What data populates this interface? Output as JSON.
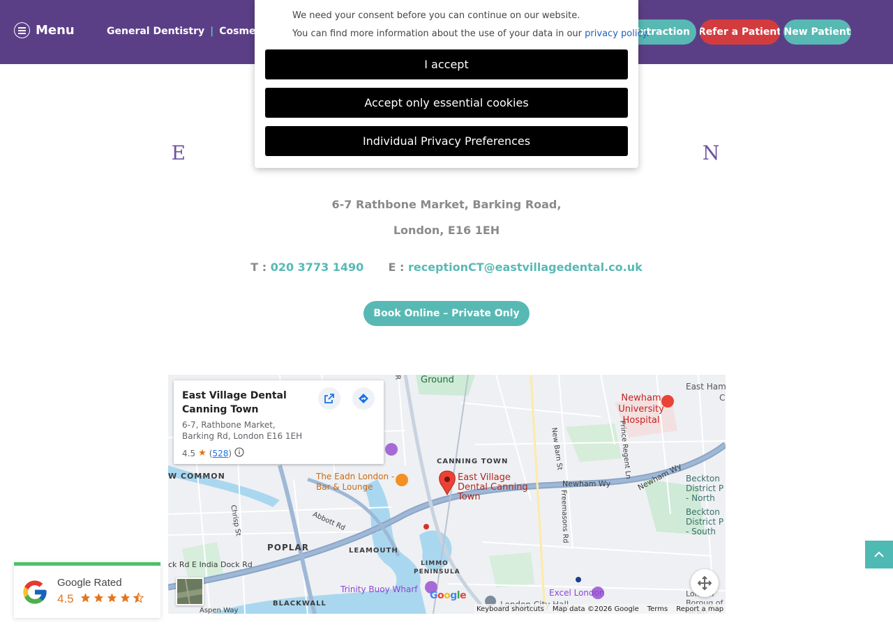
{
  "header": {
    "menu_label": "Menu",
    "nav": [
      "General Dentistry",
      "Cosmetic De"
    ],
    "buttons": {
      "extraction": "n Extraction",
      "refer": "Refer a Patient",
      "new_patient": "New Patient"
    }
  },
  "main": {
    "title": "E                                                              N",
    "address_line1": "6-7 Rathbone Market, Barking Road,",
    "address_line2": "London, E16 1EH",
    "phone_prefix": "T :",
    "phone": "020 3773 1490",
    "email_prefix": "E :",
    "email": "receptionCT@eastvillagedental.co.uk",
    "book_button": "Book Online – Private Only"
  },
  "map": {
    "card": {
      "name": "East Village Dental Canning Town",
      "address": "6-7, Rathbone Market, Barking Rd, London E16 1EH",
      "rating": "4.5",
      "count": "528"
    },
    "labels": {
      "ground": "Ground",
      "east_ham": "East Ham",
      "east_ham_c": "C",
      "newham_hospital": "Newham University Hospital",
      "canning_town": "CANNING TOWN",
      "eadn": "The Eadn London - Bar & Lounge",
      "pin": "East Village Dental Canning Town",
      "w_common": "W COMMON",
      "newham_wy": "Newham Wy",
      "newham_wy2": "Newham Wy",
      "beckton1": "Beckton District P - North",
      "beckton2": "Beckton District P - South",
      "chrisp": "Chrisp St",
      "abbott": "Abbott Rd",
      "india_dock": "ck Rd   E India Dock Rd",
      "poplar": "POPLAR",
      "leamouth": "LEAMOUTH",
      "limmo": "LIMMO PENINSULA",
      "trinity": "Trinity Buoy Wharf",
      "blackwall": "BLACKWALL",
      "aspen": "Aspen Way",
      "excel": "Excel London",
      "city_hall": "London City Hall",
      "borough": "London Boroug of Newh",
      "new_barn": "New Barn St",
      "freemasons": "Freemasons Rd",
      "prince_regent": "Prince Regent Ln",
      "r_road": "R"
    },
    "attribution": {
      "shortcuts": "Keyboard shortcuts",
      "data": "Map data ©2026 Google",
      "terms": "Terms",
      "report": "Report a map error"
    },
    "google": [
      "G",
      "o",
      "o",
      "g",
      "l",
      "e"
    ]
  },
  "badge": {
    "title": "Google Rated",
    "score": "4.5",
    "stars": 4.5
  },
  "consent": {
    "line1": "We need your consent before you can continue on our website.",
    "line2": "You can find more information about the use of your data in our",
    "link": "privacy policy",
    "period": ".",
    "accept": "I accept",
    "essential": "Accept only essential cookies",
    "individual": "Individual Privacy Preferences"
  },
  "colors": {
    "header_bg": "#5b3f86",
    "teal": "#58b9b4",
    "red": "#d33c3f",
    "title": "#6d55a0"
  }
}
